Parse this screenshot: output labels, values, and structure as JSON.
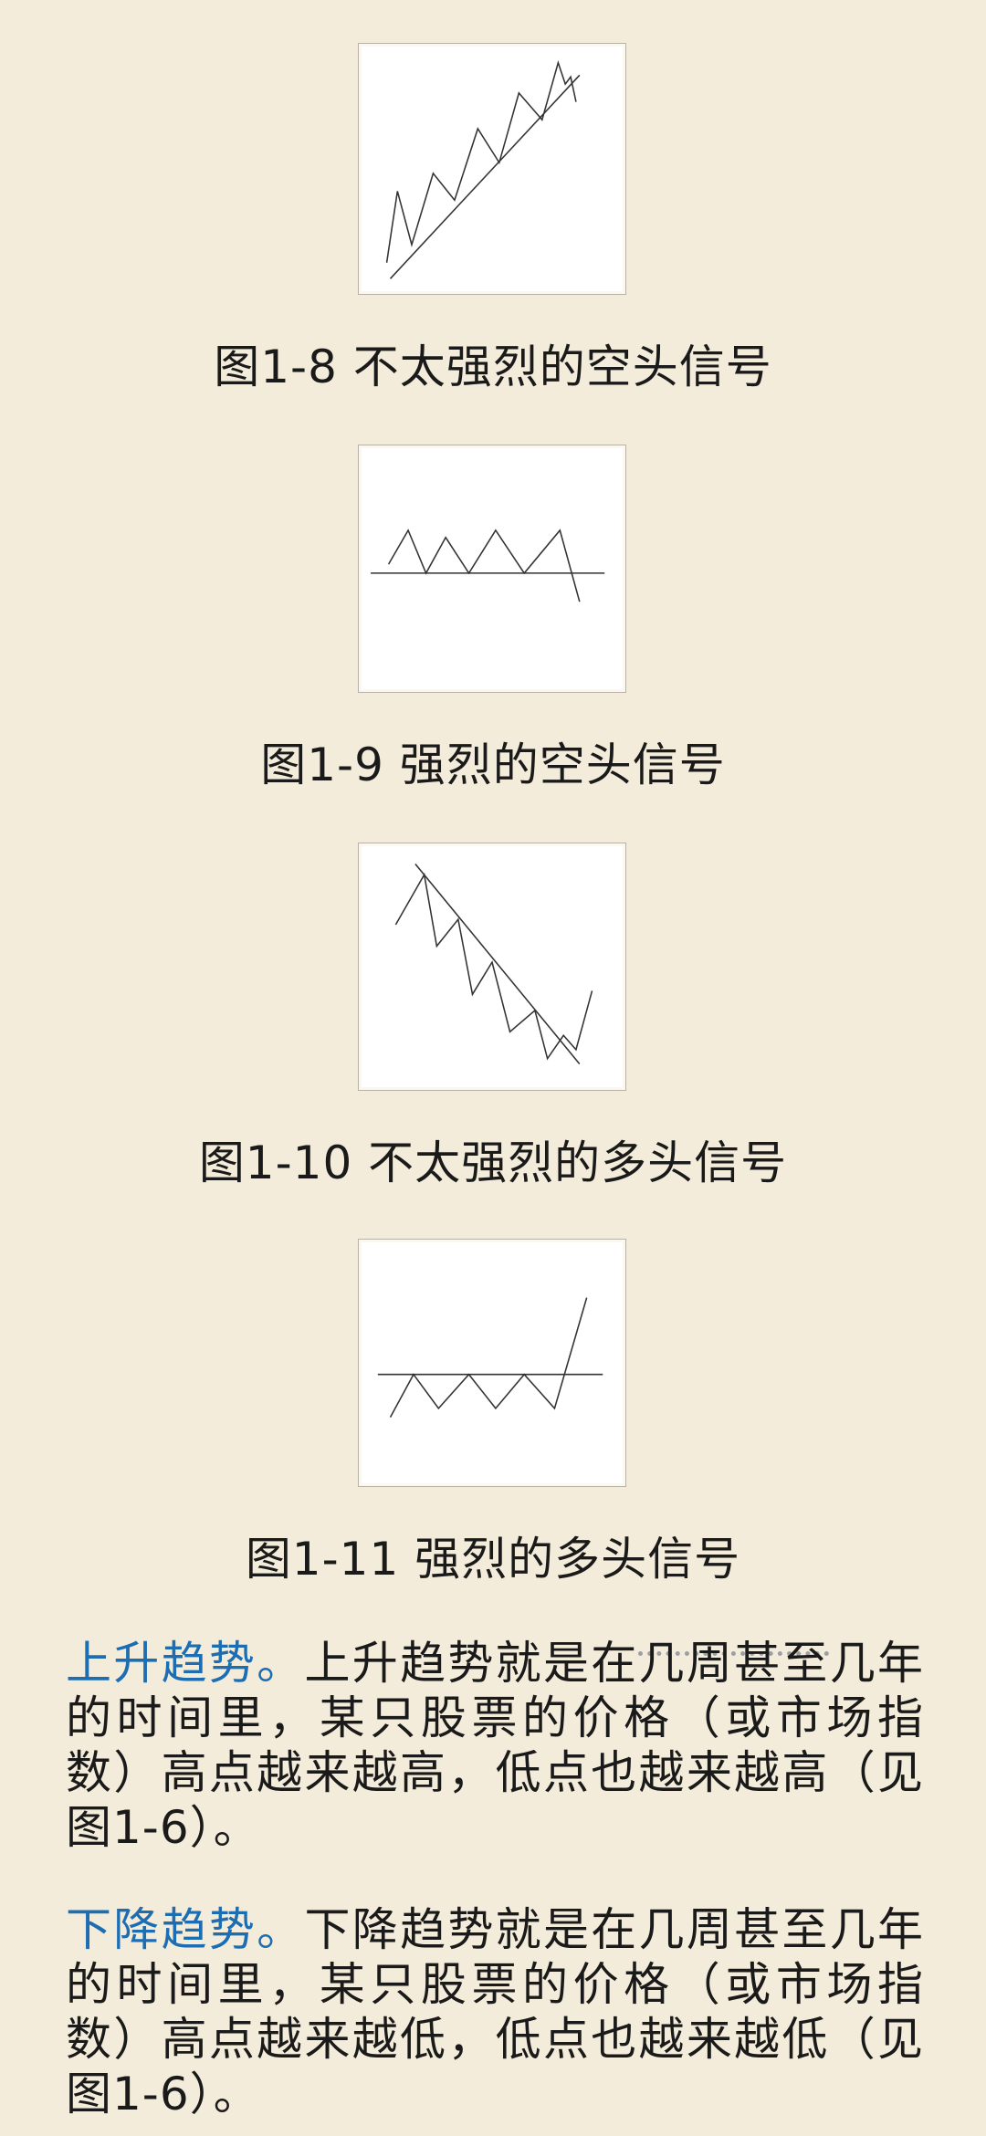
{
  "figures": [
    {
      "caption": "图1-8 不太强烈的空头信号"
    },
    {
      "caption": "图1-9 强烈的空头信号"
    },
    {
      "caption": "图1-10 不太强烈的多头信号"
    },
    {
      "caption": "图1-11 强烈的多头信号"
    }
  ],
  "paragraphs": {
    "uptrend": {
      "lead": "上升趋势。",
      "text_before_mark": "上升趋势就是在",
      "marked": "几周甚至",
      "text_after_mark": "几年的时间里，某只股票的价格（或市场指数）高点越来越高，低点也越来越高（见图1-6）。"
    },
    "downtrend": {
      "lead": "下降趋势。",
      "text": "下降趋势就是在几周甚至几年的时间里，某只股票的价格（或市场指数）高点越来越低，低点也越来越低（见图1-6）。"
    }
  }
}
